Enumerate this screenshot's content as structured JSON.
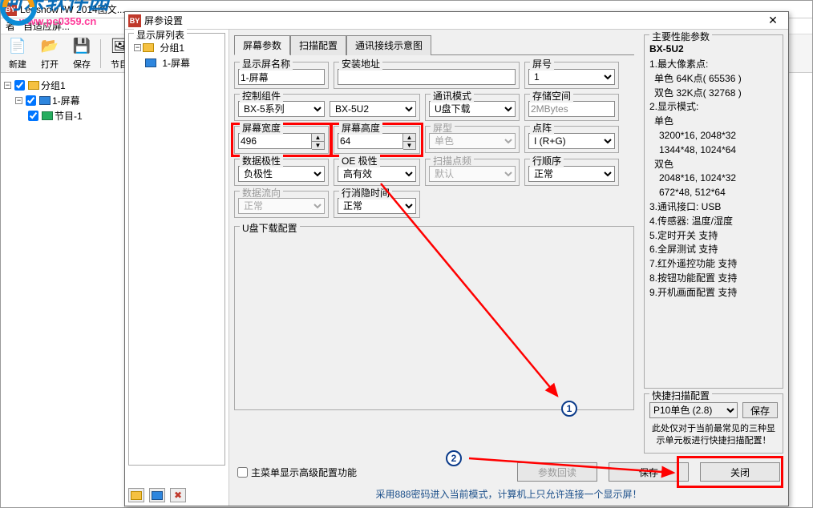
{
  "mainWindow": {
    "title": "LedshowTW 2014图文...",
    "iconText": "BY"
  },
  "watermark": {
    "text": "河东软件园",
    "url": "www.pc0359.cn"
  },
  "menubar": {
    "adapt": "自适应屏..."
  },
  "toolbar": {
    "new": "新建",
    "open": "打开",
    "save": "保存",
    "program": "节目",
    "newIcon": "📄",
    "openIcon": "📂",
    "saveIcon": "💾",
    "progIcon": "🖼"
  },
  "tree": {
    "group": "分组1",
    "screen": "1-屏幕",
    "program": "节目-1"
  },
  "dialog": {
    "title": "屏参设置",
    "leftGroup": "显示屏列表",
    "leftTree": {
      "group": "分组1",
      "screen": "1-屏幕"
    },
    "tabs": [
      "屏幕参数",
      "扫描配置",
      "通讯接线示意图"
    ],
    "fields": {
      "screenName": {
        "label": "显示屏名称",
        "value": "1-屏幕"
      },
      "installAddr": {
        "label": "安装地址",
        "value": ""
      },
      "screenNo": {
        "label": "屏号",
        "value": "1"
      },
      "ctrlGroup": {
        "label": "控制组件",
        "value": "BX-5系列",
        "value2": "BX-5U2"
      },
      "commMode": {
        "label": "通讯模式",
        "value": "U盘下载"
      },
      "storage": {
        "label": "存储空间",
        "value": "2MBytes"
      },
      "width": {
        "label": "屏幕宽度",
        "value": "496"
      },
      "height": {
        "label": "屏幕高度",
        "value": "64"
      },
      "screenType": {
        "label": "屏型",
        "value": "单色"
      },
      "dotMatrix": {
        "label": "点阵",
        "value": "I (R+G)"
      },
      "dataPolarity": {
        "label": "数据极性",
        "value": "负极性"
      },
      "oePolarity": {
        "label": "OE 极性",
        "value": "高有效"
      },
      "scanFreq": {
        "label": "扫描点频",
        "value": "默认"
      },
      "rowOrder": {
        "label": "行顺序",
        "value": "正常"
      },
      "dataFlow": {
        "label": "数据流向",
        "value": "正常"
      },
      "hideTime": {
        "label": "行消隐时间",
        "value": "正常"
      }
    },
    "usbGroup": "U盘下载配置",
    "advChk": "主菜单显示高级配置功能",
    "btnReadback": "参数回读",
    "btnSave": "保存",
    "btnClose": "关闭",
    "status": "采用888密码进入当前模式，计算机上只允许连接一个显示屏！"
  },
  "perf": {
    "title": "主要性能参数",
    "model": "BX-5U2",
    "items": [
      "1.最大像素点:",
      "  单色 64K点( 65536 )",
      "  双色 32K点( 32768 )",
      "2.显示模式:",
      "  单色",
      "   3200*16, 2048*32",
      "   1344*48, 1024*64",
      "  双色",
      "   2048*16, 1024*32",
      "   672*48, 512*64",
      "3.通讯接口: USB",
      "4.传感器: 温度/湿度",
      "5.定时开关 支持",
      "6.全屏测试 支持",
      "7.红外遥控功能 支持",
      "8.按钮功能配置 支持",
      "9.开机画面配置 支持"
    ]
  },
  "quick": {
    "title": "快捷扫描配置",
    "value": "P10单色 (2.8)",
    "save": "保存",
    "note": "此处仅对于当前最常见的三种显示单元板进行快捷扫描配置！"
  }
}
